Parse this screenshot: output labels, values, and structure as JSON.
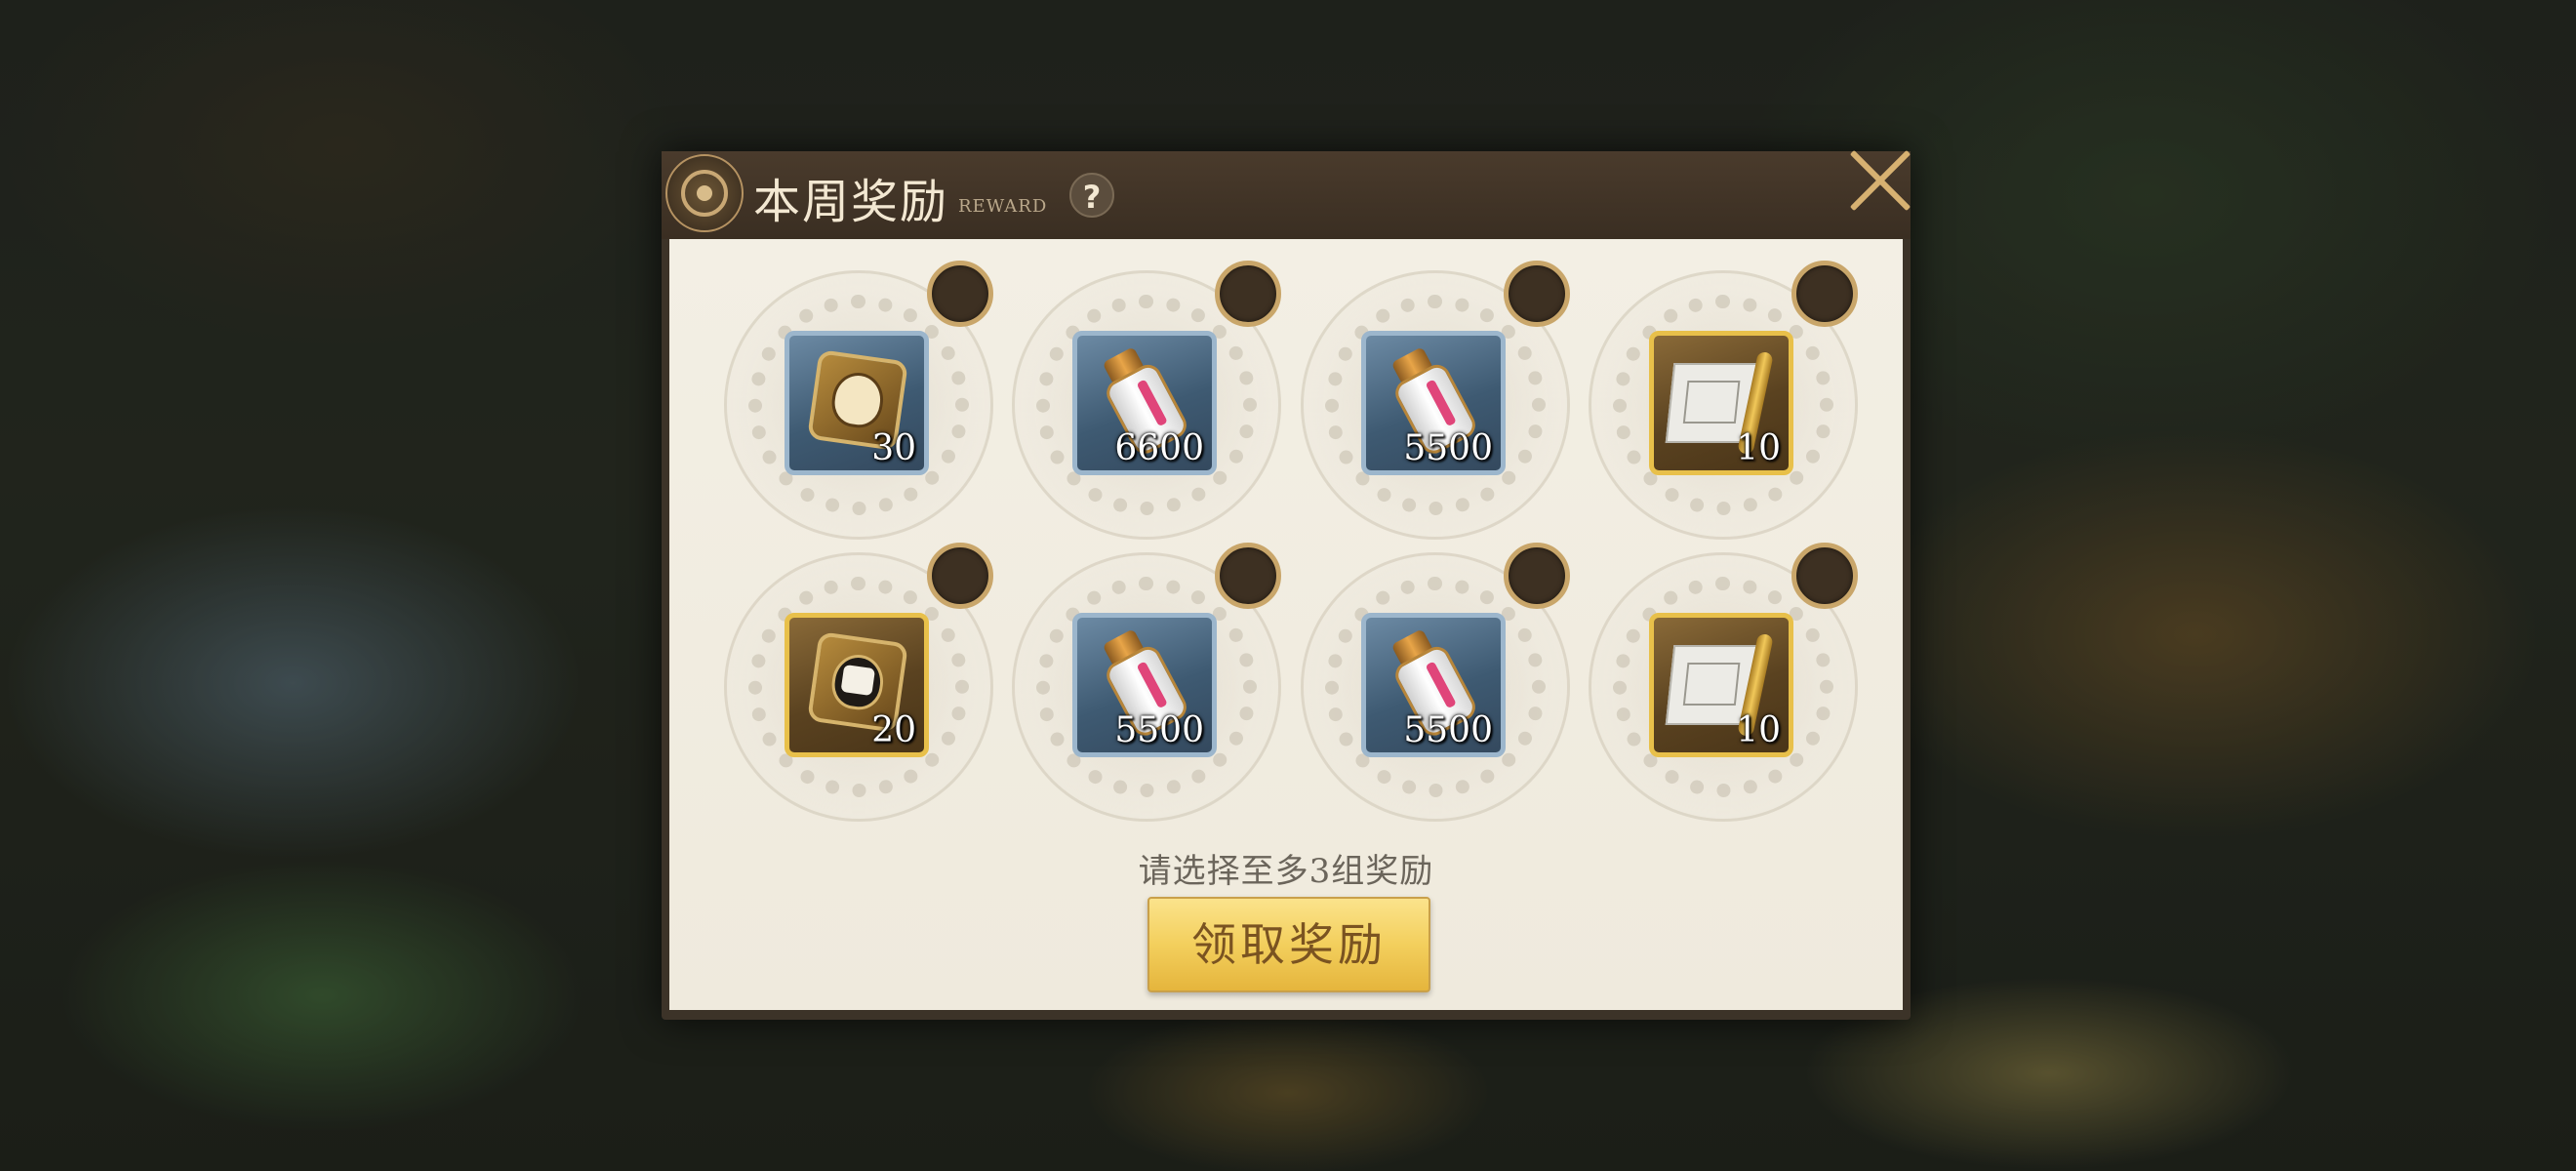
{
  "dialog": {
    "title": "本周奖励",
    "subtitle": "REWARD",
    "help_label": "?",
    "hint": "请选择至多3组奖励",
    "claim_label": "领取奖励"
  },
  "rewards": [
    {
      "item": "crest-token-light",
      "frame": "blue",
      "quantity": "30",
      "selected": false
    },
    {
      "item": "exp-potion",
      "frame": "blue",
      "quantity": "6600",
      "selected": false
    },
    {
      "item": "exp-potion",
      "frame": "blue",
      "quantity": "5500",
      "selected": false
    },
    {
      "item": "blueprint-scroll",
      "frame": "gold",
      "quantity": "10",
      "selected": false
    },
    {
      "item": "crest-token-dark",
      "frame": "gold",
      "quantity": "20",
      "selected": false
    },
    {
      "item": "exp-potion",
      "frame": "blue",
      "quantity": "5500",
      "selected": false
    },
    {
      "item": "exp-potion",
      "frame": "blue",
      "quantity": "5500",
      "selected": false
    },
    {
      "item": "blueprint-scroll",
      "frame": "gold",
      "quantity": "10",
      "selected": false
    }
  ],
  "colors": {
    "accent_gold": "#d7b171",
    "header_bg": "#3a2e22",
    "panel_bg": "#f3efe4",
    "button_gold": "#f3cf5d"
  }
}
